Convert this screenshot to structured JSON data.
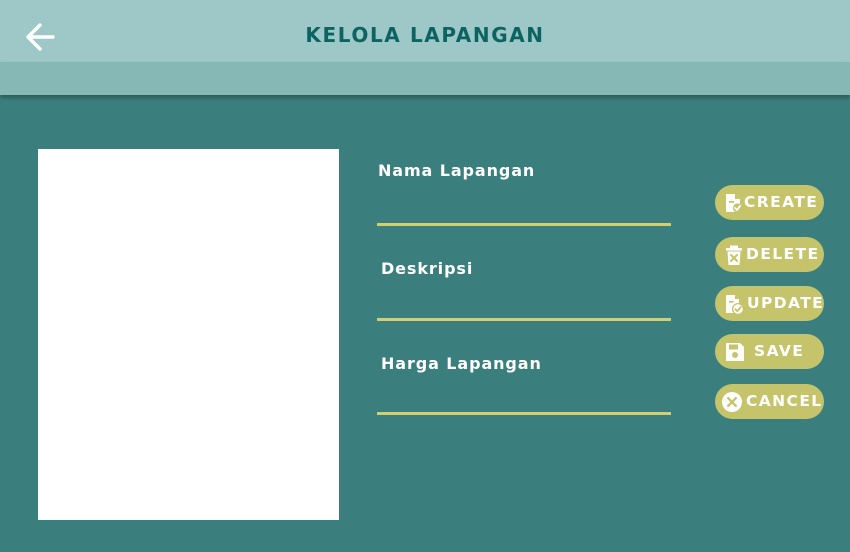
{
  "header": {
    "title": "KELOLA LAPANGAN",
    "back_icon": "arrow-left-icon"
  },
  "form": {
    "fields": [
      {
        "label": "Nama Lapangan",
        "value": ""
      },
      {
        "label": "Deskripsi",
        "value": ""
      },
      {
        "label": "Harga Lapangan",
        "value": ""
      }
    ]
  },
  "actions": [
    {
      "label": "CREATE",
      "icon": "create-file-icon"
    },
    {
      "label": "DELETE",
      "icon": "trash-icon"
    },
    {
      "label": "UPDATE",
      "icon": "update-file-icon"
    },
    {
      "label": "SAVE",
      "icon": "floppy-disk-icon"
    },
    {
      "label": "CANCEL",
      "icon": "cancel-circle-icon"
    }
  ],
  "colors": {
    "background": "#3a7f7d",
    "topbar": "#9dc8c7",
    "subbar": "#86b8b6",
    "title": "#0c6462",
    "button": "#c5c46a",
    "underline": "#d1cf71"
  }
}
